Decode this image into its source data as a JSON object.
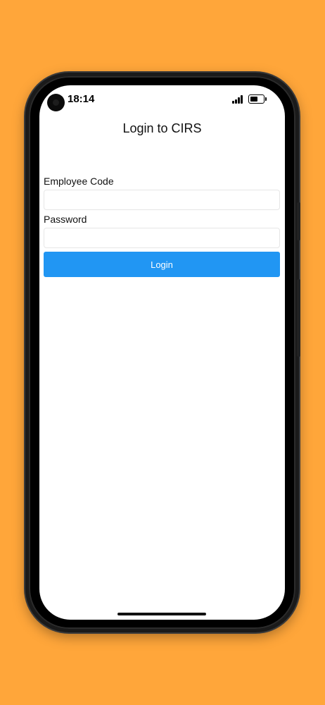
{
  "status_bar": {
    "time": "18:14",
    "icons": [
      "camera-icon",
      "signal-icon",
      "battery-icon"
    ]
  },
  "screen": {
    "title": "Login to CIRS"
  },
  "form": {
    "employee_code_label": "Employee Code",
    "employee_code_value": "",
    "employee_code_placeholder": "",
    "password_label": "Password",
    "password_value": "",
    "password_placeholder": "",
    "login_button_label": "Login"
  },
  "colors": {
    "background": "#FFA63A",
    "login_button": "#2196F3",
    "screen": "#FFFFFF"
  }
}
